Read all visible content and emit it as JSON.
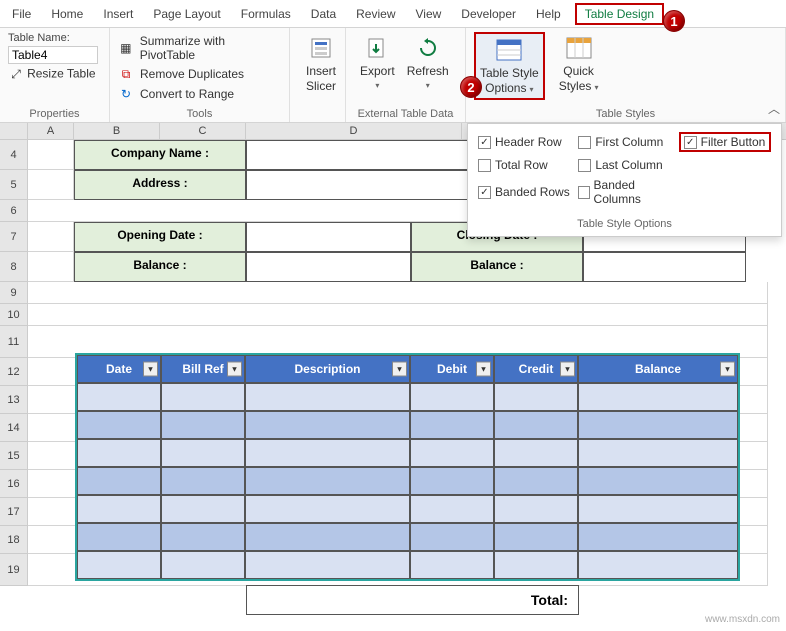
{
  "tabs": [
    "File",
    "Home",
    "Insert",
    "Page Layout",
    "Formulas",
    "Data",
    "Review",
    "View",
    "Developer",
    "Help",
    "Table Design"
  ],
  "props": {
    "label": "Table Name:",
    "value": "Table4",
    "resize": "Resize Table",
    "group": "Properties"
  },
  "tools": {
    "pivot": "Summarize with PivotTable",
    "dupes": "Remove Duplicates",
    "convert": "Convert to Range",
    "group": "Tools"
  },
  "slicer": {
    "line1": "Insert",
    "line2": "Slicer"
  },
  "extdata": {
    "export": "Export",
    "refresh": "Refresh",
    "group": "External Table Data"
  },
  "style_opts_btn": {
    "line1": "Table Style",
    "line2": "Options"
  },
  "quick_styles": {
    "line1": "Quick",
    "line2": "Styles"
  },
  "styles_group": "Table Styles",
  "panel": {
    "header_row": "Header Row",
    "first_col": "First Column",
    "filter_btn": "Filter Button",
    "total_row": "Total Row",
    "last_col": "Last Column",
    "banded_rows": "Banded Rows",
    "banded_cols": "Banded Columns",
    "label": "Table Style Options"
  },
  "cols": [
    "A",
    "B",
    "C",
    "D"
  ],
  "rows": [
    "4",
    "5",
    "6",
    "7",
    "8",
    "9",
    "10",
    "11",
    "12",
    "13",
    "14",
    "15",
    "16",
    "17",
    "18",
    "19"
  ],
  "form": {
    "company": "Company Name :",
    "address": "Address :",
    "open_date": "Opening Date :",
    "close_date": "Closing Date :",
    "bal1": "Balance :",
    "bal2": "Balance :"
  },
  "table_headers": [
    "Date",
    "Bill Ref",
    "Description",
    "Debit",
    "Credit",
    "Balance"
  ],
  "total": "Total:",
  "watermark": "www.msxdn.com"
}
